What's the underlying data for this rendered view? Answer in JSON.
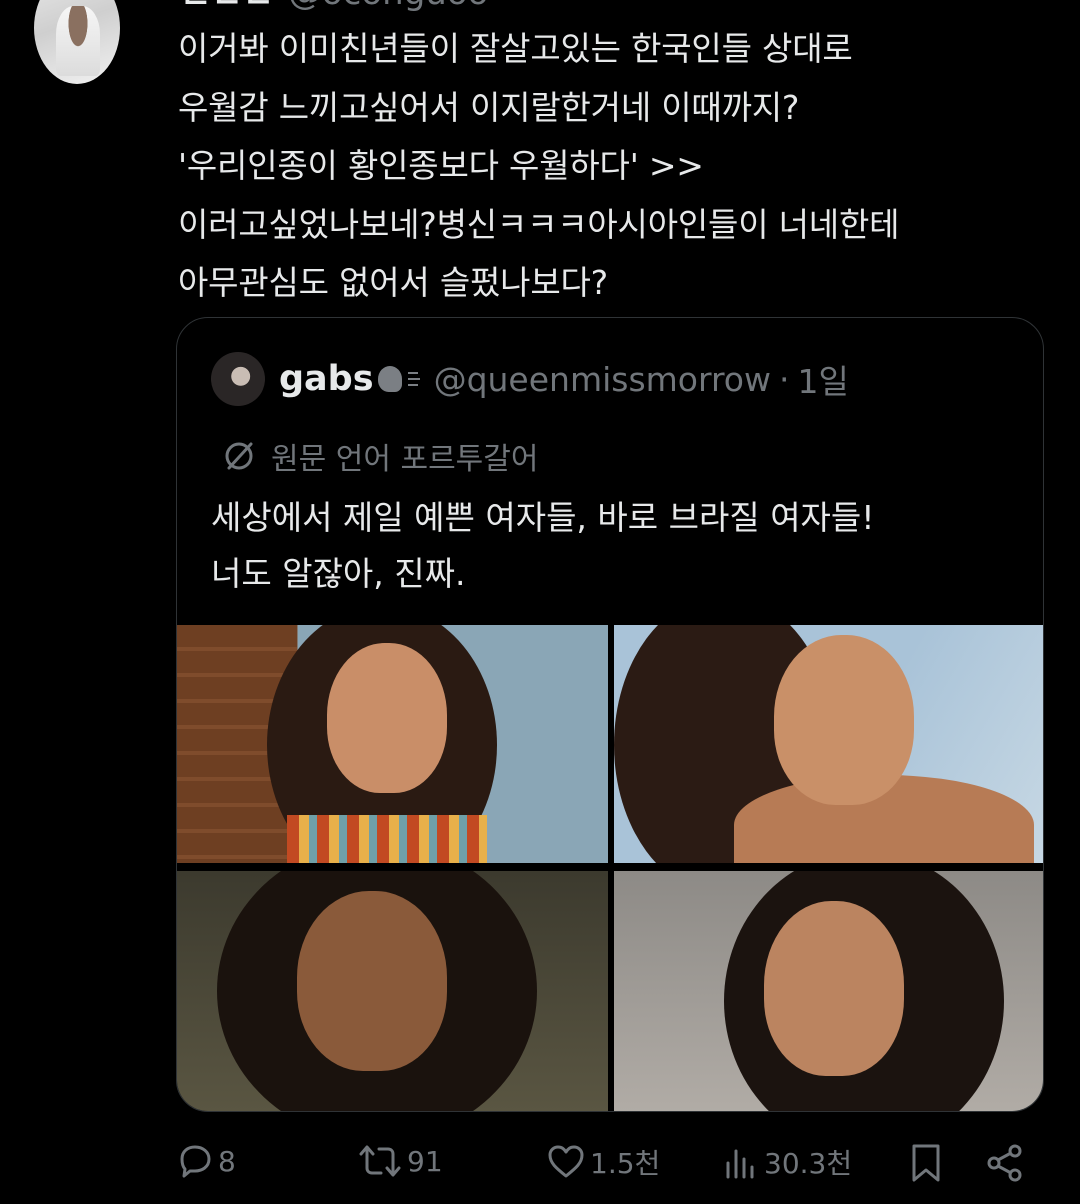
{
  "tweet": {
    "author_name": "ㄹㄴㄴ",
    "author_handle": "@oconguoo",
    "text": "이거봐 이미친년들이 잘살고있는 한국인들 상대로\n우월감 느끼고싶어서 이지랄한거네 이때까지?\n'우리인종이 황인종보다 우월하다' >>\n이러고싶었나보네?병신ㅋㅋㅋ아시아인들이 너네한테\n아무관심도 없어서  슬펐나보다?"
  },
  "quote": {
    "name": "gabs",
    "handle": "@queenmissmorrow",
    "separator": "·",
    "time": "1일",
    "translation_label": "원문 언어 포르투갈어",
    "text": "세상에서 제일 예쁜 여자들, 바로 브라질 여자들!\n너도 알잖아, 진짜."
  },
  "actions": {
    "replies": "8",
    "retweets": "91",
    "likes": "1.5천",
    "views": "30.3천"
  },
  "colors": {
    "background": "#000000",
    "text": "#e7e9ea",
    "secondary": "#71767b",
    "border": "#2f3336"
  },
  "icons": [
    "reply-icon",
    "retweet-icon",
    "like-icon",
    "views-icon",
    "bookmark-icon",
    "share-icon",
    "translate-icon",
    "speaking-head-icon"
  ]
}
